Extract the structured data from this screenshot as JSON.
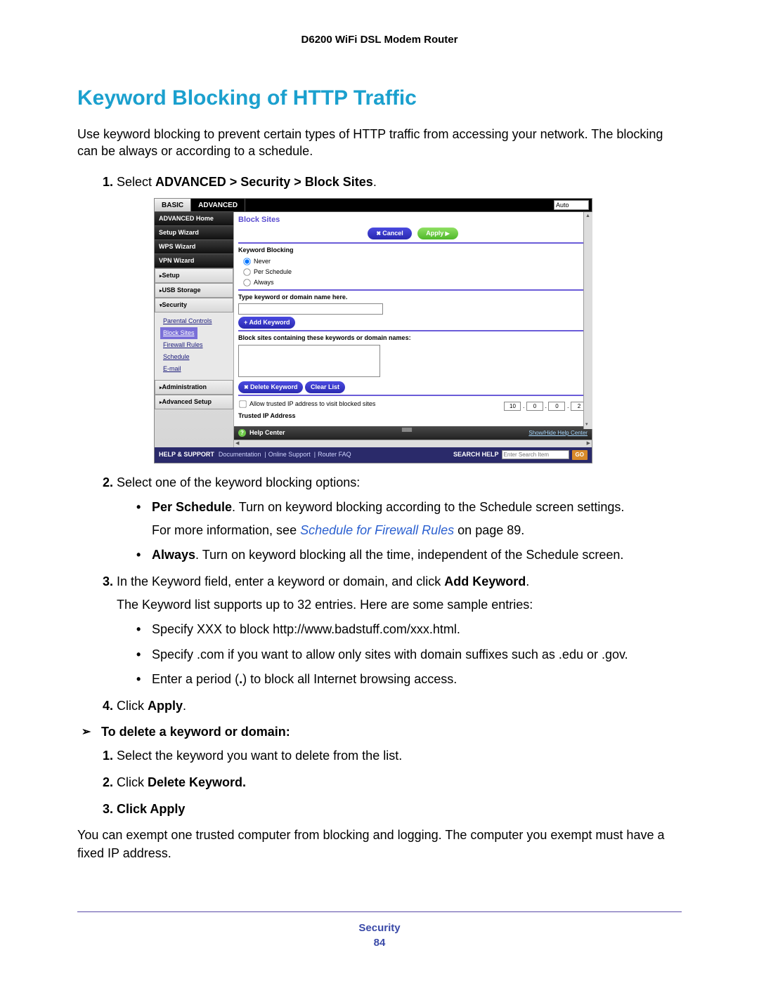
{
  "product_header": "D6200 WiFi DSL Modem Router",
  "title": "Keyword Blocking of HTTP Traffic",
  "intro": "Use keyword blocking to prevent certain types of HTTP traffic from accessing your network. The blocking can be always or according to a schedule.",
  "step1_prefix": "Select ",
  "step1_bold": "ADVANCED > Security > Block Sites",
  "step1_suffix": ".",
  "step2": "Select one of the keyword blocking options:",
  "step2_b1_bold": "Per Schedule",
  "step2_b1_rest": ". Turn on keyword blocking according to the Schedule screen settings.",
  "step2_more_a": "For more information, see ",
  "step2_more_link": "Schedule for Firewall Rules",
  "step2_more_b": " on page 89.",
  "step2_b2_bold": "Always",
  "step2_b2_rest": ". Turn on keyword blocking all the time, independent of the Schedule screen.",
  "step3_a": "In the Keyword field, enter a keyword or domain, and click ",
  "step3_bold": "Add Keyword",
  "step3_b": ".",
  "step3_note": "The Keyword list supports up to 32 entries. Here are some sample entries:",
  "step3_s1": "Specify XXX to block http://www.badstuff.com/xxx.html.",
  "step3_s2": "Specify .com if you want to allow only sites with domain suffixes such as .edu or .gov.",
  "step3_s3_a": "Enter a period (",
  "step3_s3_b": ".",
  "step3_s3_c": ") to block all Internet browsing access.",
  "step4_a": "Click ",
  "step4_bold": "Apply",
  "step4_b": ".",
  "proc_title": "To delete a keyword or domain:",
  "d1": "Select the keyword you want to delete from the list.",
  "d2_a": "Click ",
  "d2_bold": "Delete Keyword.",
  "d3": "Click Apply",
  "trail": "You can exempt one trusted computer from blocking and logging. The computer you exempt must have a fixed IP address.",
  "footer_section": "Security",
  "footer_page": "84",
  "ui": {
    "tab_basic": "BASIC",
    "tab_advanced": "ADVANCED",
    "auto": "Auto",
    "sidebar_top": [
      "ADVANCED Home",
      "Setup Wizard",
      "WPS Wizard",
      "VPN Wizard"
    ],
    "sidebar_exp": [
      "Setup",
      "USB Storage"
    ],
    "sidebar_security": "Security",
    "sidebar_subs": [
      "Parental Controls",
      "Block Sites",
      "Firewall Rules",
      "Schedule",
      "E-mail"
    ],
    "sidebar_bottom": [
      "Administration",
      "Advanced Setup"
    ],
    "crumb": "Block Sites",
    "cancel": "Cancel",
    "apply": "Apply",
    "kw_block": "Keyword Blocking",
    "opt_never": "Never",
    "opt_sched": "Per Schedule",
    "opt_always": "Always",
    "type_kw": "Type keyword or domain name here.",
    "add_kw": "Add Keyword",
    "block_list": "Block sites containing these keywords or domain names:",
    "del_kw": "Delete Keyword",
    "clear": "Clear List",
    "allow_trusted": "Allow trusted IP address to visit blocked sites",
    "trusted_ip": "Trusted IP Address",
    "ip": [
      "10",
      "0",
      "0",
      "2"
    ],
    "help_center": "Help Center",
    "show_hide": "Show/Hide Help Center",
    "help_support": "HELP & SUPPORT",
    "doc": "Documentation",
    "online": "Online Support",
    "faq": "Router FAQ",
    "search_help": "SEARCH HELP",
    "search_ph": "Enter Search Item",
    "go": "GO"
  }
}
